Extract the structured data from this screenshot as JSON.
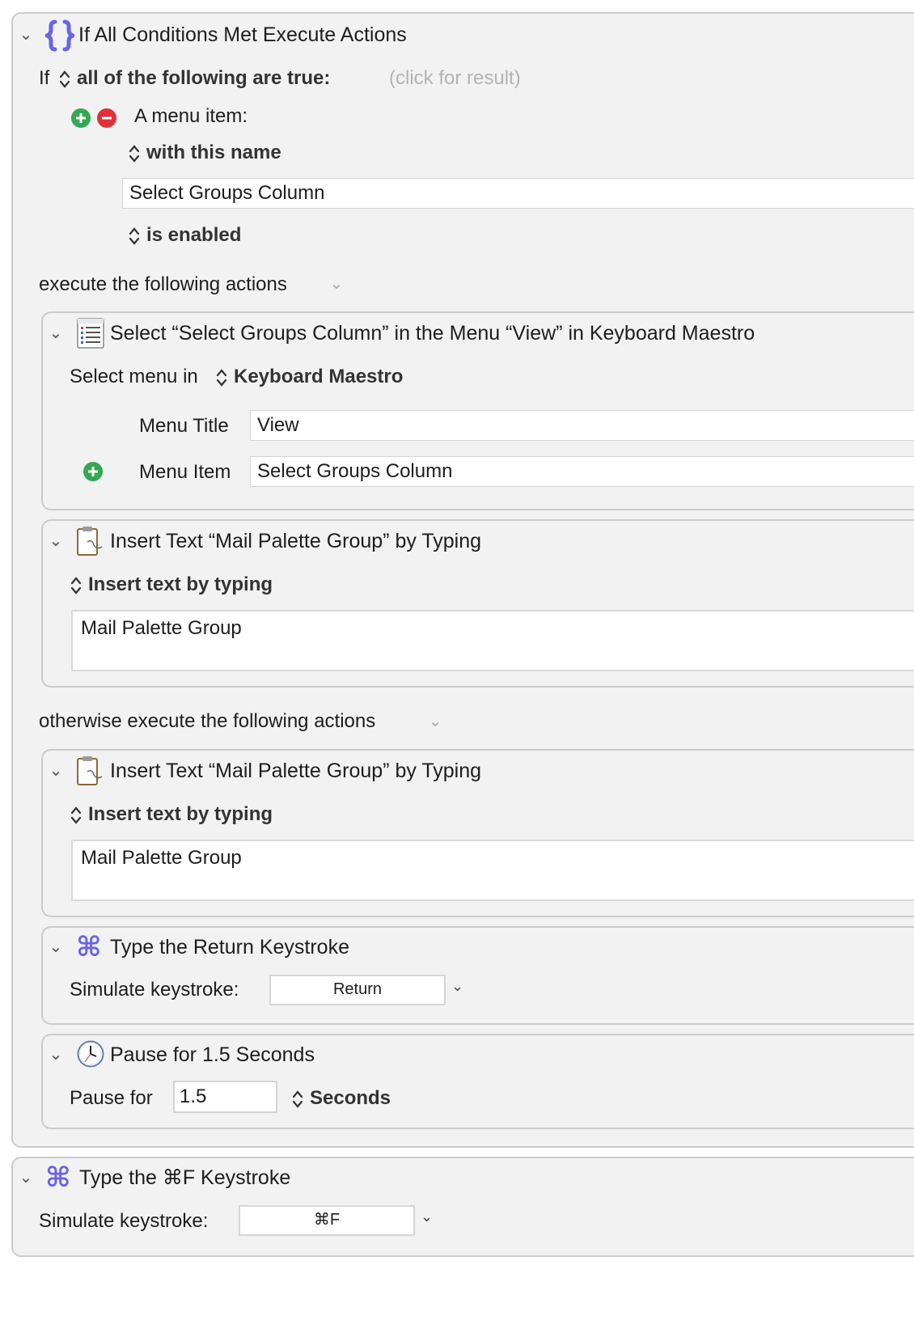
{
  "if_block": {
    "title": "If All Conditions Met Execute Actions",
    "if_label": "If",
    "condition_mode": "all of the following are true:",
    "result_hint": "(click for result)",
    "condition": {
      "type_label": "A menu item:",
      "match_mode": "with this name",
      "name_value": "Select Groups Column",
      "state": "is enabled"
    },
    "execute_label": "execute the following actions",
    "otherwise_label": "otherwise execute the following actions"
  },
  "actions_then": [
    {
      "title": "Select “Select Groups Column” in the Menu “View” in Keyboard Maestro",
      "select_menu_in_label": "Select menu in",
      "app": "Keyboard Maestro",
      "menu_title_label": "Menu Title",
      "menu_title_value": "View",
      "menu_item_label": "Menu Item",
      "menu_item_value": "Select Groups Column"
    },
    {
      "title": "Insert Text “Mail Palette Group” by Typing",
      "mode": "Insert text by typing",
      "text": "Mail Palette Group"
    }
  ],
  "actions_else": [
    {
      "title": "Insert Text “Mail Palette Group” by Typing",
      "mode": "Insert text by typing",
      "text": "Mail Palette Group"
    },
    {
      "title": "Type the Return Keystroke",
      "simulate_label": "Simulate keystroke:",
      "keystroke": "Return"
    },
    {
      "title": "Pause for 1.5 Seconds",
      "pause_label": "Pause for",
      "value": "1.5",
      "unit": "Seconds"
    }
  ],
  "outer_action": {
    "title": "Type the ⌘F Keystroke",
    "simulate_label": "Simulate keystroke:",
    "keystroke": "⌘F"
  },
  "colors": {
    "panel_bg": "#f2f2f2",
    "icon_purple": "#6b63e8",
    "add_green": "#34a853",
    "remove_red": "#e0303a"
  }
}
